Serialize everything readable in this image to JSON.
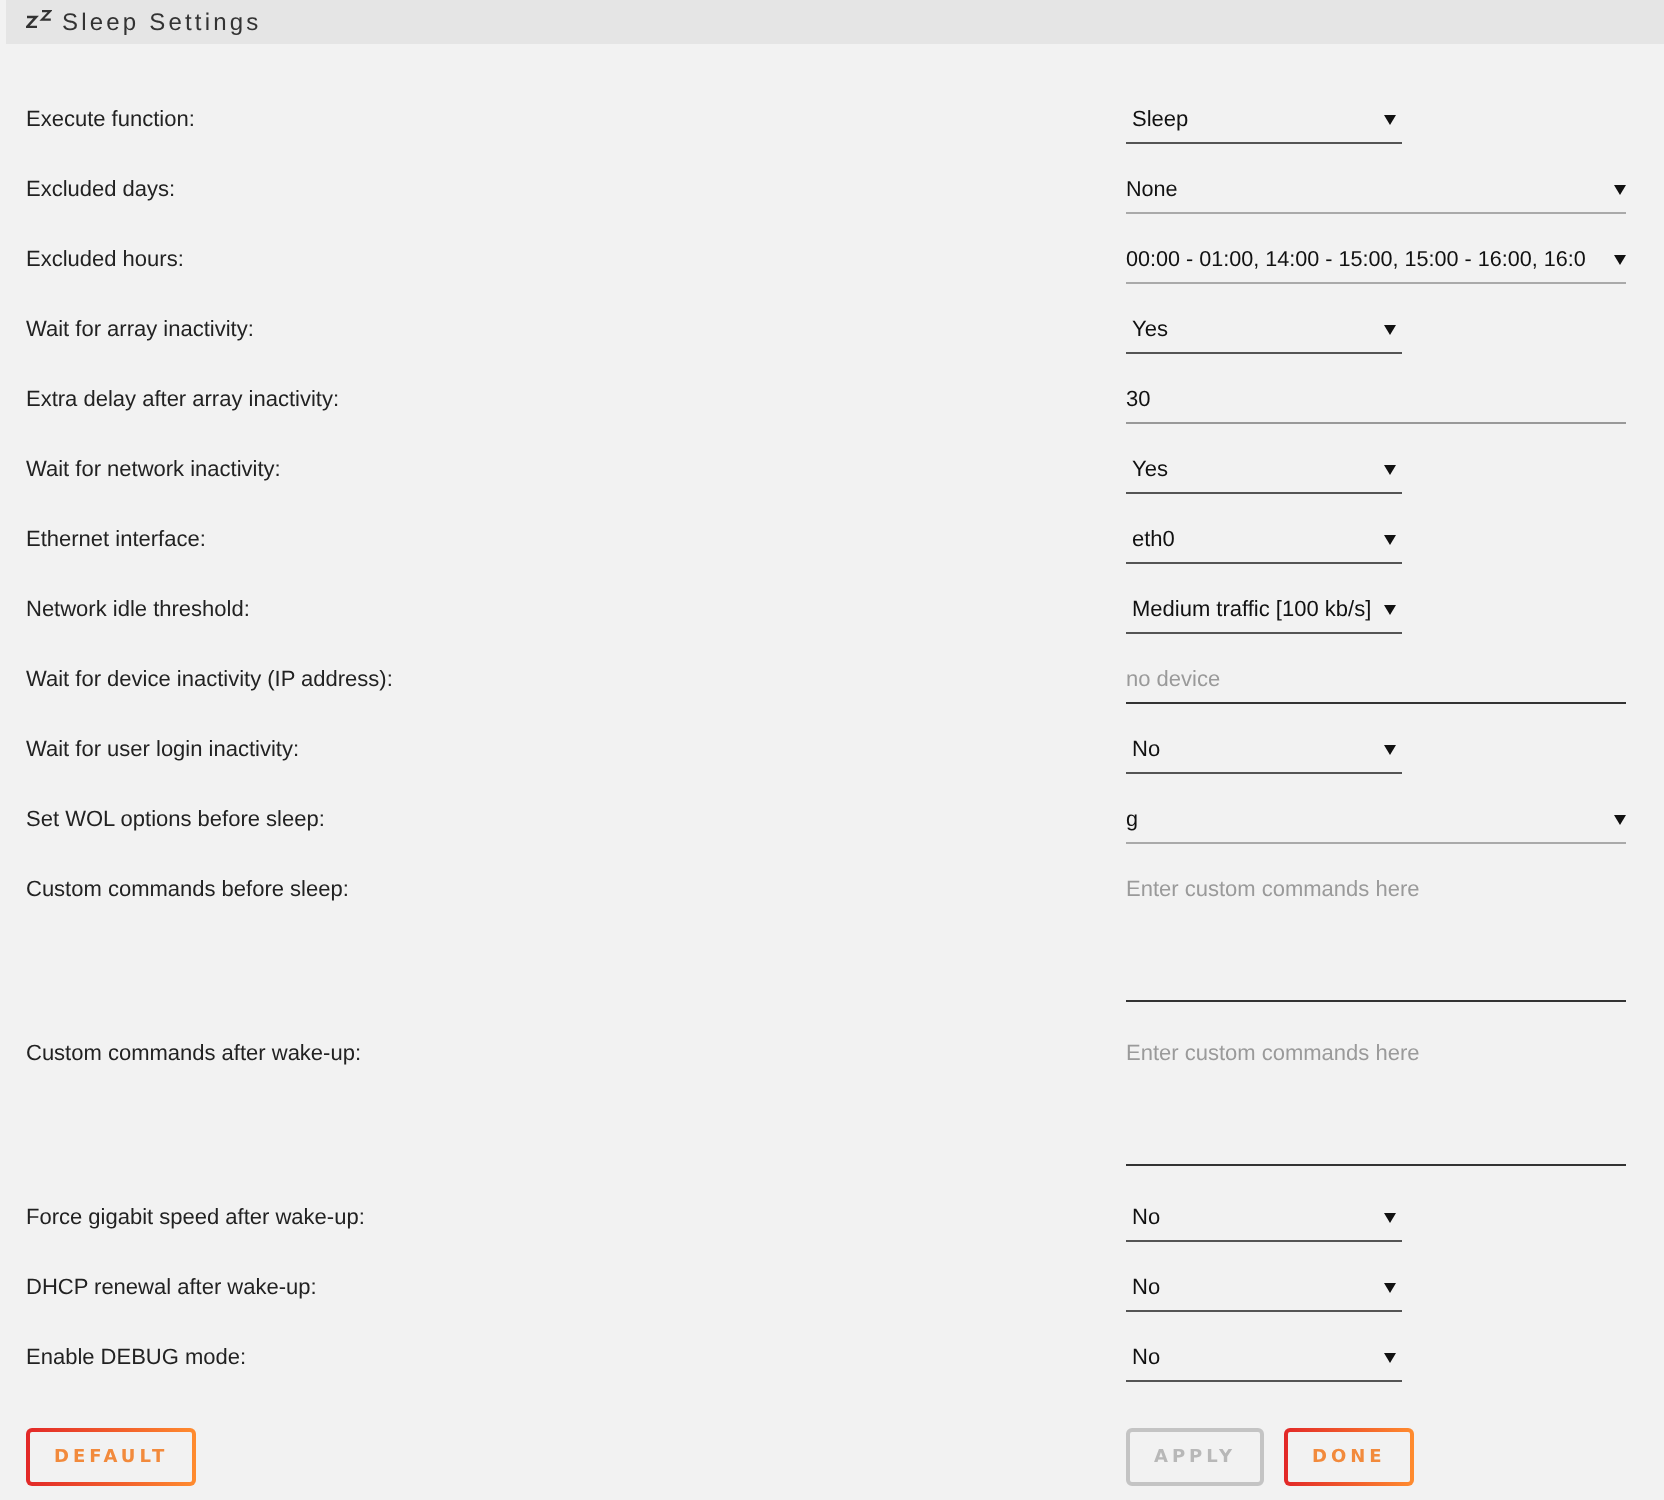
{
  "section": {
    "title": "Sleep Settings"
  },
  "settings": [
    {
      "label": "Execute function:",
      "kind": "select",
      "value": "Sleep"
    },
    {
      "label": "Excluded days:",
      "kind": "multiselect",
      "value": "None"
    },
    {
      "label": "Excluded hours:",
      "kind": "multiselect",
      "value": "00:00 - 01:00, 14:00 - 15:00, 15:00 - 16:00, 16:0"
    },
    {
      "label": "Wait for array inactivity:",
      "kind": "select",
      "value": "Yes"
    },
    {
      "label": "Extra delay after array inactivity:",
      "kind": "text",
      "value": "30"
    },
    {
      "label": "Wait for network inactivity:",
      "kind": "select",
      "value": "Yes"
    },
    {
      "label": "Ethernet interface:",
      "kind": "select",
      "value": "eth0"
    },
    {
      "label": "Network idle threshold:",
      "kind": "select",
      "value": "Medium traffic [100 kb/s]"
    },
    {
      "label": "Wait for device inactivity (IP address):",
      "kind": "text",
      "placeholder": "no device"
    },
    {
      "label": "Wait for user login inactivity:",
      "kind": "select",
      "value": "No"
    },
    {
      "label": "Set WOL options before sleep:",
      "kind": "multiselect",
      "value": "g"
    },
    {
      "label": "Custom commands before sleep:",
      "kind": "textarea",
      "placeholder": "Enter custom commands here"
    },
    {
      "label": "Custom commands after wake-up:",
      "kind": "textarea",
      "placeholder": "Enter custom commands here"
    },
    {
      "label": "Force gigabit speed after wake-up:",
      "kind": "select",
      "value": "No"
    },
    {
      "label": "DHCP renewal after wake-up:",
      "kind": "select",
      "value": "No"
    },
    {
      "label": "Enable DEBUG mode:",
      "kind": "select",
      "value": "No"
    }
  ],
  "footer": {
    "left_buttons": [
      {
        "label": "DEFAULT",
        "disabled": false
      }
    ],
    "right_buttons": [
      {
        "label": "APPLY",
        "disabled": true
      },
      {
        "label": "DONE",
        "disabled": false
      }
    ]
  }
}
